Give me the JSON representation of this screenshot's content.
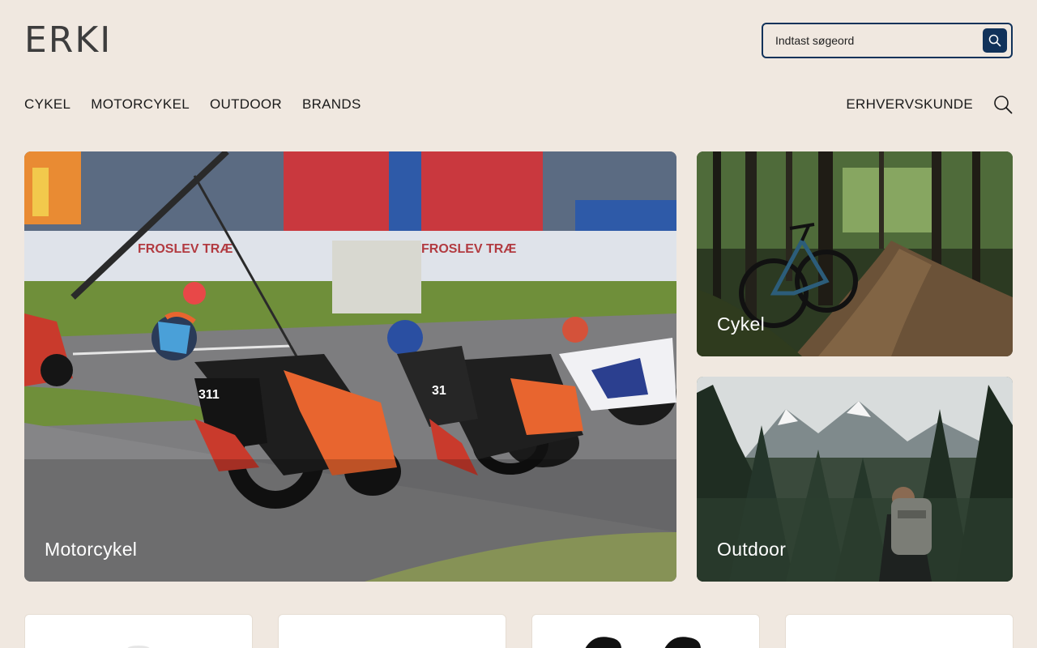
{
  "brand": {
    "logo_text": "ERKI"
  },
  "search": {
    "placeholder": "Indtast søgeord"
  },
  "nav": {
    "items": [
      {
        "label": "CYKEL"
      },
      {
        "label": "MOTORCYKEL"
      },
      {
        "label": "OUTDOOR"
      },
      {
        "label": "BRANDS"
      }
    ],
    "business_label": "ERHVERVSKUNDE"
  },
  "tiles": {
    "motorcycle": {
      "label": "Motorcykel"
    },
    "bicycle": {
      "label": "Cykel"
    },
    "outdoor": {
      "label": "Outdoor"
    }
  },
  "colors": {
    "background": "#f0e8e0",
    "accent": "#11325a",
    "text": "#1a1a1a"
  },
  "icons": {
    "search_button": "search-icon",
    "nav_search": "magnifier-icon"
  }
}
